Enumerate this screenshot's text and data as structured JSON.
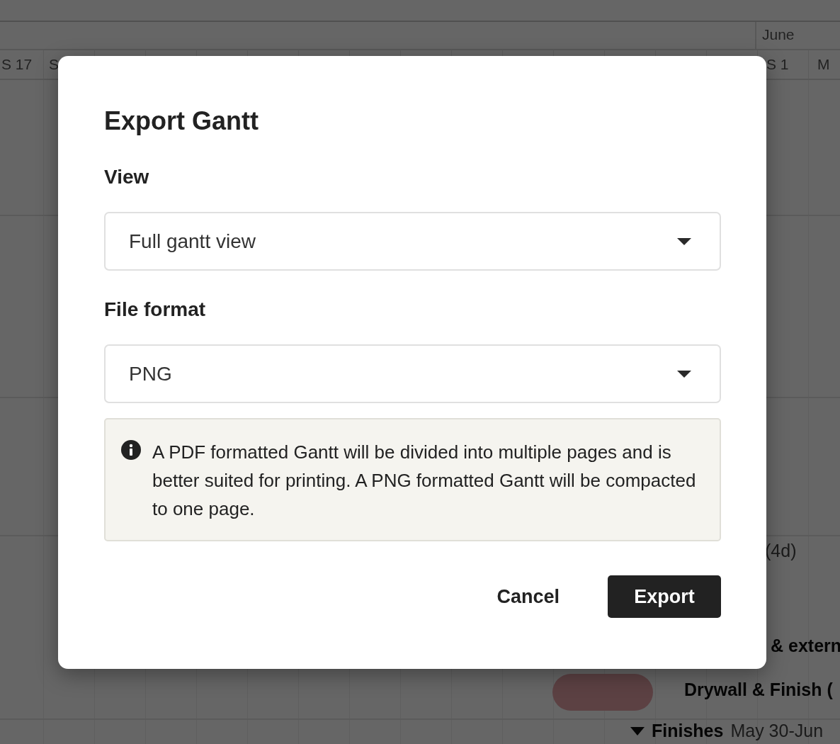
{
  "gantt": {
    "month_label": "June",
    "days_left": [
      {
        "label": "S 17"
      },
      {
        "label": "S"
      }
    ],
    "days_right": [
      {
        "label": "S 1"
      },
      {
        "label": "M"
      }
    ],
    "items": [
      {
        "kind": "duration",
        "text": "(4d)"
      },
      {
        "kind": "task",
        "text": "& extern"
      },
      {
        "kind": "bar"
      },
      {
        "kind": "task",
        "text": "Drywall & Finish ("
      },
      {
        "kind": "group",
        "name": "Finishes",
        "dates": "May 30-Jun",
        "expanded": true
      }
    ]
  },
  "dialog": {
    "title": "Export Gantt",
    "fields": [
      {
        "label": "View",
        "value": "Full gantt view"
      },
      {
        "label": "File format",
        "value": "PNG"
      }
    ],
    "info": "A PDF formatted Gantt will be divided into multiple pages and is better suited for printing. A PNG formatted Gantt will be compacted to one page.",
    "buttons": [
      {
        "kind": "secondary",
        "label": "Cancel"
      },
      {
        "kind": "primary",
        "label": "Export"
      }
    ]
  }
}
